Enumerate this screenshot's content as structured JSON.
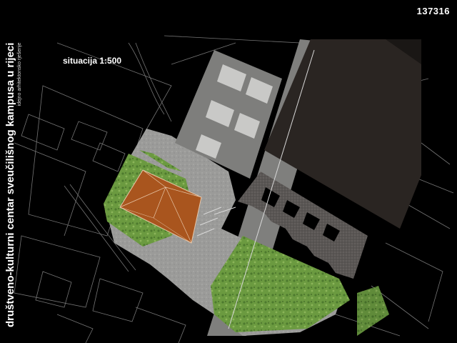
{
  "sheet": {
    "code": "137316",
    "scale_label": "situacija 1:500",
    "title": "društveno-kulturni centar sveučilišnog kampusa u rijeci",
    "subtitle": "idejno arhitektonsko rješenje"
  },
  "colors": {
    "background": "#000000",
    "plaza": "#9a9a98",
    "lawn": "#6f9a45",
    "roof_copper": "#a9551e",
    "dark_block": "#2a2522",
    "lines": "#8a8a8a"
  }
}
